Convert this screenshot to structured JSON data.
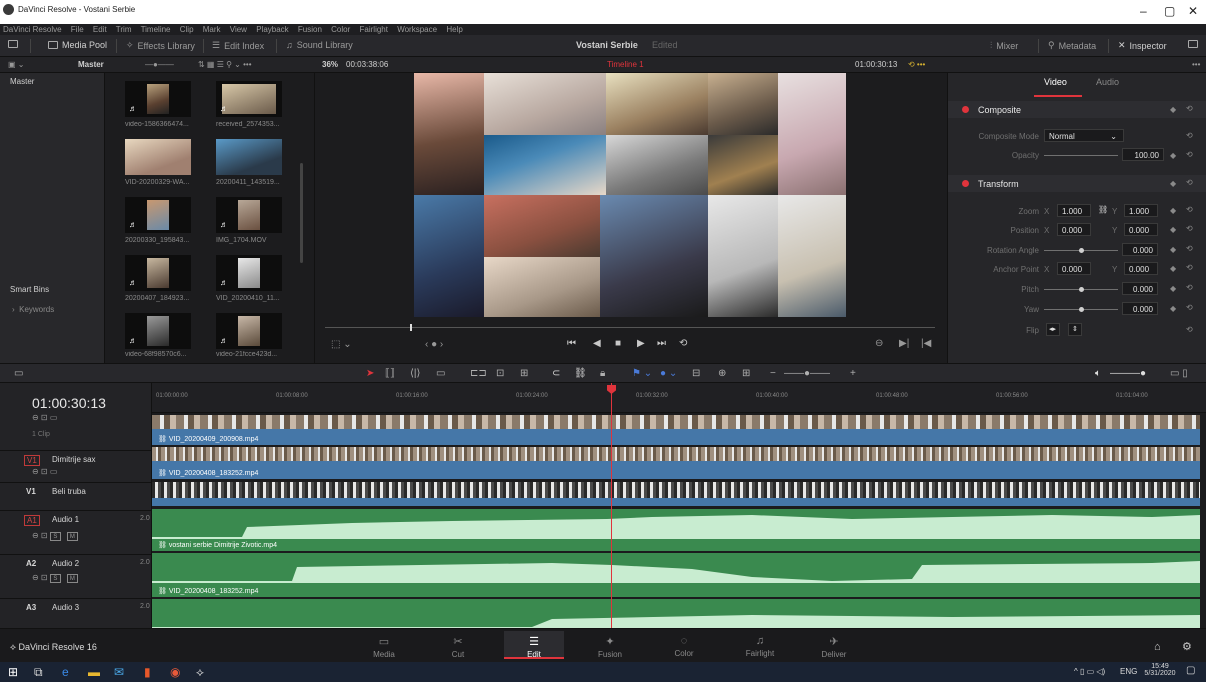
{
  "window": {
    "title": "DaVinci Resolve - Vostani Serbie",
    "controls": [
      "–",
      "▢",
      "✕"
    ]
  },
  "menu": [
    "DaVinci Resolve",
    "File",
    "Edit",
    "Trim",
    "Timeline",
    "Clip",
    "Mark",
    "View",
    "Playback",
    "Fusion",
    "Color",
    "Fairlight",
    "Workspace",
    "Help"
  ],
  "toolbar": {
    "media_pool": "Media Pool",
    "effects_library": "Effects Library",
    "edit_index": "Edit Index",
    "sound_library": "Sound Library",
    "project_title": "Vostani Serbie",
    "project_status": "Edited",
    "mixer": "Mixer",
    "metadata": "Metadata",
    "inspector": "Inspector"
  },
  "subbar": {
    "bin": "Master",
    "zoom": "36%",
    "source_tc": "00:03:38:06",
    "timeline_name": "Timeline 1",
    "record_tc": "01:00:30:13"
  },
  "bins": {
    "master": "Master",
    "smart_bins": "Smart Bins",
    "keywords": "Keywords"
  },
  "media_pool": {
    "clips": [
      {
        "label": "video-1586366474..."
      },
      {
        "label": "received_2574353..."
      },
      {
        "label": "VID-20200329-WA..."
      },
      {
        "label": "20200411_143519..."
      },
      {
        "label": "20200330_195843..."
      },
      {
        "label": "IMG_1704.MOV"
      },
      {
        "label": "20200407_184923..."
      },
      {
        "label": "VID_20200410_11..."
      },
      {
        "label": "video-68f98570c6..."
      },
      {
        "label": "video-21fcce423d..."
      }
    ]
  },
  "inspector": {
    "tabs": [
      "Video",
      "Audio"
    ],
    "composite": {
      "title": "Composite",
      "mode_label": "Composite Mode",
      "mode_value": "Normal",
      "opacity_label": "Opacity",
      "opacity_value": "100.00",
      "opacity_level": 1.0
    },
    "transform": {
      "title": "Transform",
      "zoom_label": "Zoom",
      "zoom_x": "1.000",
      "zoom_y": "1.000",
      "position_label": "Position",
      "position_x": "0.000",
      "position_y": "0.000",
      "rotation_label": "Rotation Angle",
      "rotation_value": "0.000",
      "anchor_label": "Anchor Point",
      "anchor_x": "0.000",
      "anchor_y": "0.000",
      "pitch_label": "Pitch",
      "pitch_value": "0.000",
      "yaw_label": "Yaw",
      "yaw_value": "0.000",
      "flip_label": "Flip",
      "x_label": "X",
      "y_label": "Y"
    }
  },
  "timeline": {
    "timecode": "01:00:30:13",
    "ruler_ticks": [
      "01:00:00:00",
      "01:00:08:00",
      "01:00:16:00",
      "01:00:24:00",
      "01:00:32:00",
      "01:00:40:00",
      "01:00:48:00",
      "01:00:56:00",
      "01:01:04:00"
    ],
    "tracks": {
      "v_top_clip": "1 Clip",
      "v1_a": {
        "id": "V1",
        "name": "Dimitrije sax"
      },
      "v1_b": {
        "id": "V1",
        "name": "Beli truba"
      },
      "a1": {
        "id": "A1",
        "name": "Audio 1",
        "ch": "2.0"
      },
      "a2": {
        "id": "A2",
        "name": "Audio 2",
        "ch": "2.0"
      },
      "a3": {
        "id": "A3",
        "name": "Audio 3",
        "ch": "2.0"
      }
    },
    "clips": {
      "v_top": "VID_20200409_200908.mp4",
      "v_mid": "VID_20200408_183252.mp4",
      "a1": "vostani serbie Dimitrije Zivotic.mp4",
      "a2": "VID_20200408_183252.mp4"
    },
    "track_buttons": {
      "s": "S",
      "m": "M"
    }
  },
  "pages": [
    {
      "label": "Media",
      "icon": "▭"
    },
    {
      "label": "Cut",
      "icon": "✂"
    },
    {
      "label": "Edit",
      "icon": "☰"
    },
    {
      "label": "Fusion",
      "icon": "✦"
    },
    {
      "label": "Color",
      "icon": "◌"
    },
    {
      "label": "Fairlight",
      "icon": "♫"
    },
    {
      "label": "Deliver",
      "icon": "✈"
    }
  ],
  "app_name": "DaVinci Resolve 16",
  "taskbar": {
    "lang": "ENG",
    "time": "15:49",
    "date": "5/31/2020"
  },
  "colors": {
    "accent": "#e0343c",
    "video_clip": "#4577a8",
    "audio_clip": "#3a8a4f"
  }
}
